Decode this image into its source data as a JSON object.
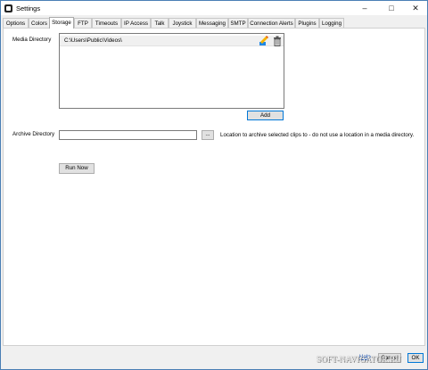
{
  "window": {
    "title": "Settings"
  },
  "tabs": [
    "Options",
    "Colors",
    "Storage",
    "FTP",
    "Timeouts",
    "IP Access",
    "Talk",
    "Joystick",
    "Messaging",
    "SMTP",
    "Connection Alerts",
    "Plugins",
    "Logging"
  ],
  "active_tab": "Storage",
  "storage": {
    "media_directory_label": "Media Directory",
    "media_directories": [
      "C:\\Users\\Public\\Videos\\"
    ],
    "add_label": "Add",
    "archive_directory_label": "Archive Directory",
    "archive_value": "",
    "browse_label": "...",
    "archive_hint": "Location to archive selected clips to - do not use a location in a media directory.",
    "run_now_label": "Run Now"
  },
  "footer": {
    "help_label": "Help",
    "cancel_label": "Cancel",
    "ok_label": "OK"
  },
  "watermark": "SOFT-NAVIGATOR.RU"
}
